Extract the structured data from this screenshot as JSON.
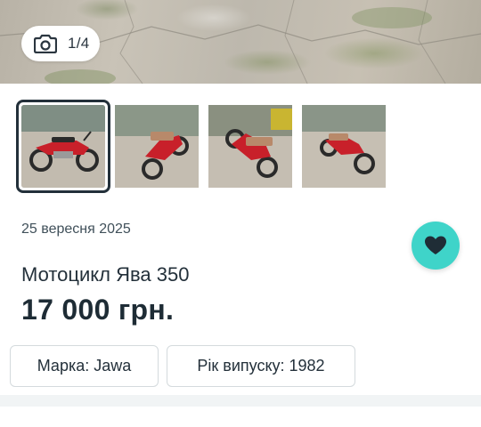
{
  "gallery": {
    "counter": "1/4",
    "icon": "camera-icon",
    "thumbnails": [
      {
        "name": "thumbnail-1",
        "active": true
      },
      {
        "name": "thumbnail-2",
        "active": false
      },
      {
        "name": "thumbnail-3",
        "active": false
      },
      {
        "name": "thumbnail-4",
        "active": false
      }
    ]
  },
  "listing": {
    "date": "25 вересня 2025",
    "title": "Мотоцикл Ява 350",
    "price": "17 000 грн.",
    "favorite_icon": "heart-icon",
    "params": [
      {
        "label": "Марка: Jawa"
      },
      {
        "label": "Рік випуску: 1982"
      }
    ]
  },
  "colors": {
    "accent": "#3fd4c9",
    "text": "#23303a",
    "motorcycle_red": "#c8202a"
  }
}
